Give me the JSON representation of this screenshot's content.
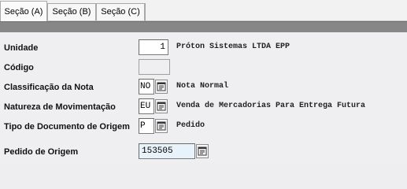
{
  "tabs": [
    {
      "label": "Seção (A)",
      "active": true
    },
    {
      "label": "Seção (B)",
      "active": false
    },
    {
      "label": "Seção (C)",
      "active": false
    }
  ],
  "form": {
    "unidade": {
      "label": "Unidade",
      "value": "1",
      "description": "Próton Sistemas LTDA EPP"
    },
    "codigo": {
      "label": "Código",
      "value": ""
    },
    "classificacao": {
      "label": "Classificação da Nota",
      "value": "NO",
      "description": "Nota Normal"
    },
    "natureza": {
      "label": "Natureza de Movimentação",
      "value": "EU",
      "description": "Venda de Mercadorias Para Entrega Futura"
    },
    "tipo_documento": {
      "label": "Tipo de Documento de Origem",
      "value": "P",
      "description": "Pedido"
    },
    "pedido_origem": {
      "label": "Pedido de Origem",
      "value": "153505"
    }
  },
  "icons": {
    "lookup": "lookup-list-icon"
  }
}
